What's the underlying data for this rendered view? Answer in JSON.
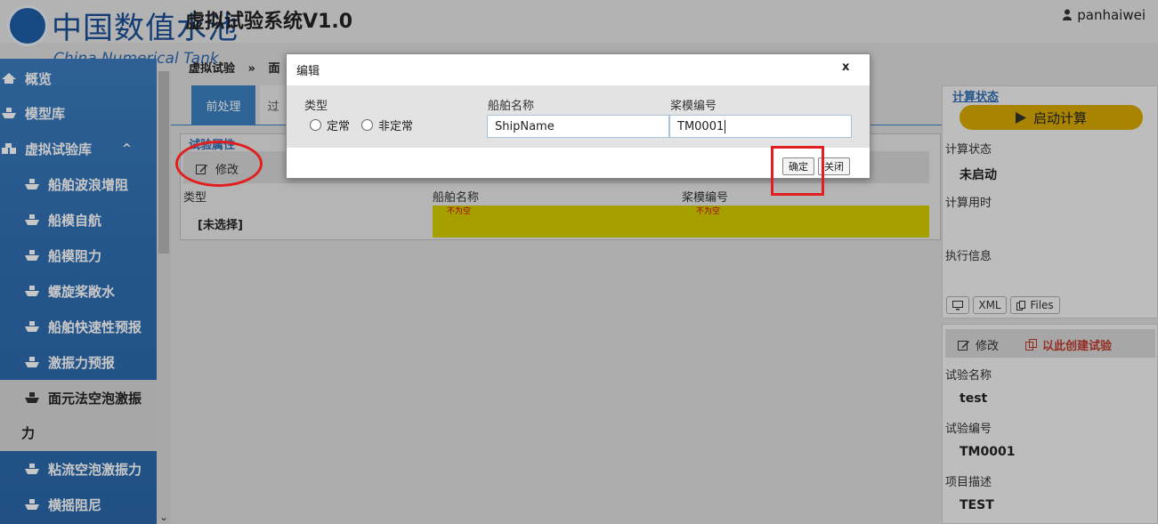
{
  "header": {
    "app_title": "虚拟试验系统V1.0",
    "user": "panhaiwei",
    "logo_cn": "中国数值水池",
    "logo_en": "China Numerical Tank"
  },
  "sidebar": {
    "items": [
      {
        "label": "概览"
      },
      {
        "label": "模型库"
      },
      {
        "label": "虚拟试验库",
        "suffix": "^"
      },
      {
        "label": "船舶波浪增阻"
      },
      {
        "label": "船模自航"
      },
      {
        "label": "船模阻力"
      },
      {
        "label": "螺旋桨敞水"
      },
      {
        "label": "船舶快速性预报"
      },
      {
        "label": "激振力预报"
      },
      {
        "label": "面元法空泡激振",
        "label2": "力"
      },
      {
        "label": "粘流空泡激振力"
      },
      {
        "label": "横摇阻尼"
      }
    ]
  },
  "breadcrumb": {
    "root": "虚拟试验",
    "sep": "»",
    "current": "面"
  },
  "tabs": [
    {
      "label": "前处理"
    },
    {
      "label": "过"
    }
  ],
  "panel": {
    "legend": "试验属性",
    "edit_label": "修改",
    "columns": [
      "类型",
      "船舶名称",
      "桨模编号"
    ],
    "type_value": "[未选择]",
    "error_text": "不为空"
  },
  "right": {
    "status_title": "计算状态",
    "start_button": "启动计算",
    "calc_status_label": "计算状态",
    "calc_status_value": "未启动",
    "calc_time_label": "计算用时",
    "exec_info_label": "执行信息",
    "btn_xml": "XML",
    "btn_files": "Files",
    "edit_label": "修改",
    "create_label": "以此创建试验",
    "test_name_label": "试验名称",
    "test_name_value": "test",
    "test_no_label": "试验编号",
    "test_no_value": "TM0001",
    "desc_label": "项目描述",
    "desc_value": "TEST"
  },
  "modal": {
    "title": "编辑",
    "close": "x",
    "type_label": "类型",
    "radio_1": "定常",
    "radio_2": "非定常",
    "ship_label": "船舶名称",
    "ship_value": "ShipName",
    "prop_label": "桨模编号",
    "prop_value": "TM0001",
    "ok": "确定",
    "cancel": "关闭"
  },
  "colors": {
    "accent": "#3a7fc1",
    "highlight": "#e02020",
    "start": "#d9a900",
    "invalid": "#d4cc00"
  }
}
